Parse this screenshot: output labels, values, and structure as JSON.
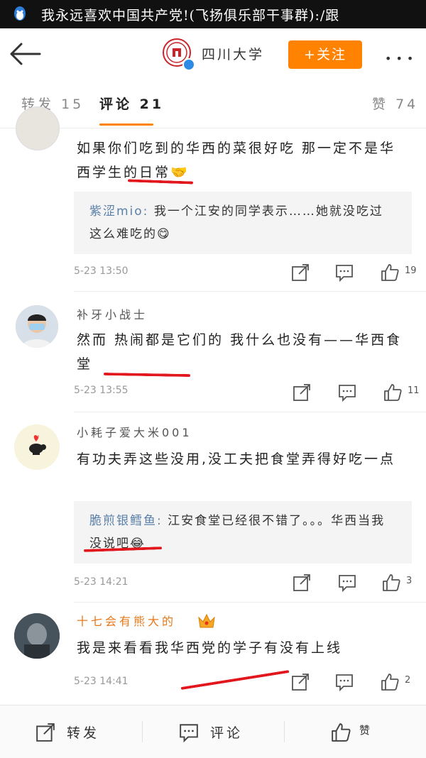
{
  "status_bar": {
    "ticker": "我永远喜欢中国共产党!(飞扬俱乐部干事群):/跟"
  },
  "nav": {
    "account_name": "四川大学",
    "follow_label": "+关注",
    "more_label": "•••"
  },
  "tabs": [
    {
      "label": "转发",
      "count": "15"
    },
    {
      "label": "评论",
      "count": "21"
    },
    {
      "label": "赞",
      "count": "74"
    }
  ],
  "comments": [
    {
      "text": "如果你们吃到的华西的菜很好吃 那一定不是华西学生的日常🤝",
      "reply": {
        "author": "紫涩mio:",
        "text": "我一个江安的同学表示……她就没吃过这么难吃的😋"
      },
      "time": "5-23 13:50",
      "likes": "19"
    },
    {
      "username": "补牙小战士",
      "text": "然而 热闹都是它们的 我什么也没有——华西食堂",
      "time": "5-23 13:55",
      "likes": "11"
    },
    {
      "username": "小耗子爱大米001",
      "text": "有功夫弄这些没用,没工夫把食堂弄得好吃一点",
      "reply": {
        "author": "脆煎银鳕鱼:",
        "text": "江安食堂已经很不错了。。。华西当我没说吧😂"
      },
      "time": "5-23 14:21",
      "likes": "3"
    },
    {
      "username": "十七会有熊大的",
      "text": "我是来看看我华西党的学子有没有上线",
      "time": "5-23 14:41",
      "likes": "2"
    }
  ],
  "bottom_bar": {
    "repost_label": "转发",
    "comment_label": "评论",
    "like_label": "赞"
  },
  "colors": {
    "accent": "#ff8200",
    "highlight_marker": "#e2161d",
    "reply_author": "#5a7fa8",
    "vip_name": "#e87818"
  },
  "icons": [
    "qq-icon",
    "back-arrow-icon",
    "share-icon",
    "comment-icon",
    "like-icon",
    "crown-icon",
    "verified-icon"
  ]
}
